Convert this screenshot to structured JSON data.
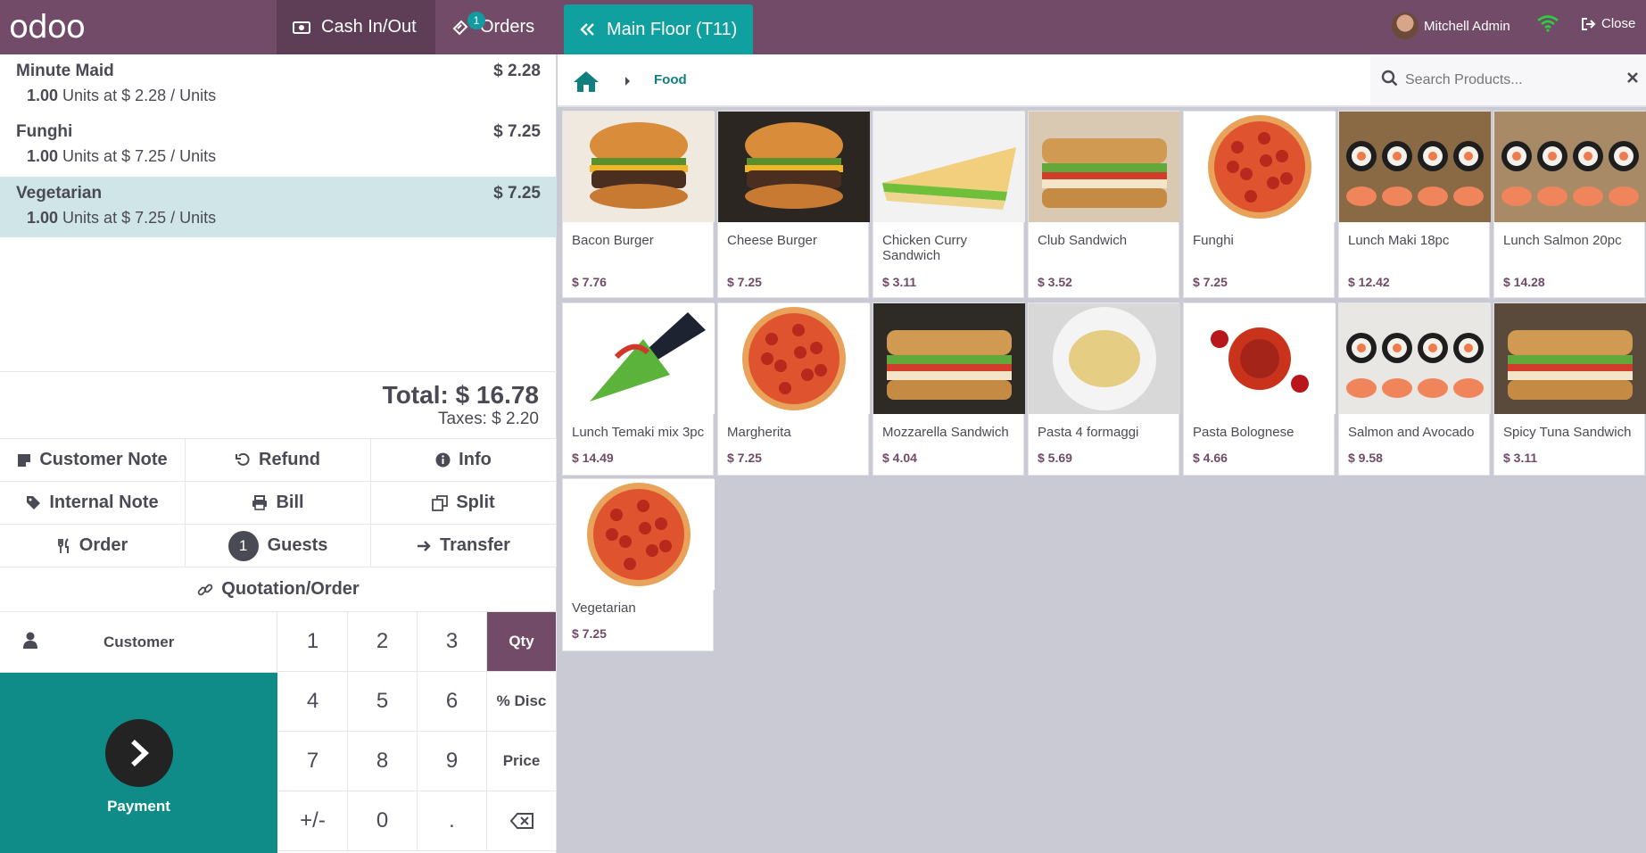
{
  "header": {
    "logo": "odoo",
    "cash_label": "Cash In/Out",
    "orders_label": "Orders",
    "orders_badge": "1",
    "floor_label": "Main Floor (T11)",
    "user_name": "Mitchell Admin",
    "close_label": "Close",
    "wifi_color": "#2ecc40"
  },
  "order": {
    "lines": [
      {
        "name": "Minute Maid",
        "price": "$ 2.28",
        "qty": "1.00",
        "detail": " Units at $ 2.28 / Units",
        "selected": false
      },
      {
        "name": "Funghi",
        "price": "$ 7.25",
        "qty": "1.00",
        "detail": " Units at $ 7.25 / Units",
        "selected": false
      },
      {
        "name": "Vegetarian",
        "price": "$ 7.25",
        "qty": "1.00",
        "detail": " Units at $ 7.25 / Units",
        "selected": true
      }
    ],
    "total": "Total: $ 16.78",
    "taxes": "Taxes: $ 2.20"
  },
  "controls": {
    "customer_note": "Customer Note",
    "refund": "Refund",
    "info": "Info",
    "internal_note": "Internal Note",
    "bill": "Bill",
    "split": "Split",
    "order": "Order",
    "guests_count": "1",
    "guests": "Guests",
    "transfer": "Transfer",
    "quotation": "Quotation/Order"
  },
  "numpad": {
    "customer": "Customer",
    "payment": "Payment",
    "keys": [
      "1",
      "2",
      "3",
      "Qty",
      "4",
      "5",
      "6",
      "% Disc",
      "7",
      "8",
      "9",
      "Price",
      "+/-",
      "0",
      "."
    ],
    "active_mode": "Qty"
  },
  "products_bar": {
    "crumb": "Food",
    "search_placeholder": "Search Products..."
  },
  "products": [
    {
      "name": "Bacon Burger",
      "price": "$ 7.76",
      "img": "burger"
    },
    {
      "name": "Cheese Burger",
      "price": "$ 7.25",
      "img": "burger-dark"
    },
    {
      "name": "Chicken Curry Sandwich",
      "price": "$ 3.11",
      "img": "sandwich-tri"
    },
    {
      "name": "Club Sandwich",
      "price": "$ 3.52",
      "img": "club"
    },
    {
      "name": "Funghi",
      "price": "$ 7.25",
      "img": "pizza-white"
    },
    {
      "name": "Lunch Maki 18pc",
      "price": "$ 12.42",
      "img": "maki"
    },
    {
      "name": "Lunch Salmon 20pc",
      "price": "$ 14.28",
      "img": "salmon"
    },
    {
      "name": "Lunch Temaki mix 3pc",
      "price": "$ 14.49",
      "img": "temaki"
    },
    {
      "name": "Margherita",
      "price": "$ 7.25",
      "img": "pizza-white"
    },
    {
      "name": "Mozzarella Sandwich",
      "price": "$ 4.04",
      "img": "mozza"
    },
    {
      "name": "Pasta 4 formaggi",
      "price": "$ 5.69",
      "img": "pasta"
    },
    {
      "name": "Pasta Bolognese",
      "price": "$ 4.66",
      "img": "bolognese"
    },
    {
      "name": "Salmon and Avocado",
      "price": "$ 9.58",
      "img": "salmon-avo"
    },
    {
      "name": "Spicy Tuna Sandwich",
      "price": "$ 3.11",
      "img": "tuna"
    },
    {
      "name": "Vegetarian",
      "price": "$ 7.25",
      "img": "pizza-white"
    }
  ]
}
